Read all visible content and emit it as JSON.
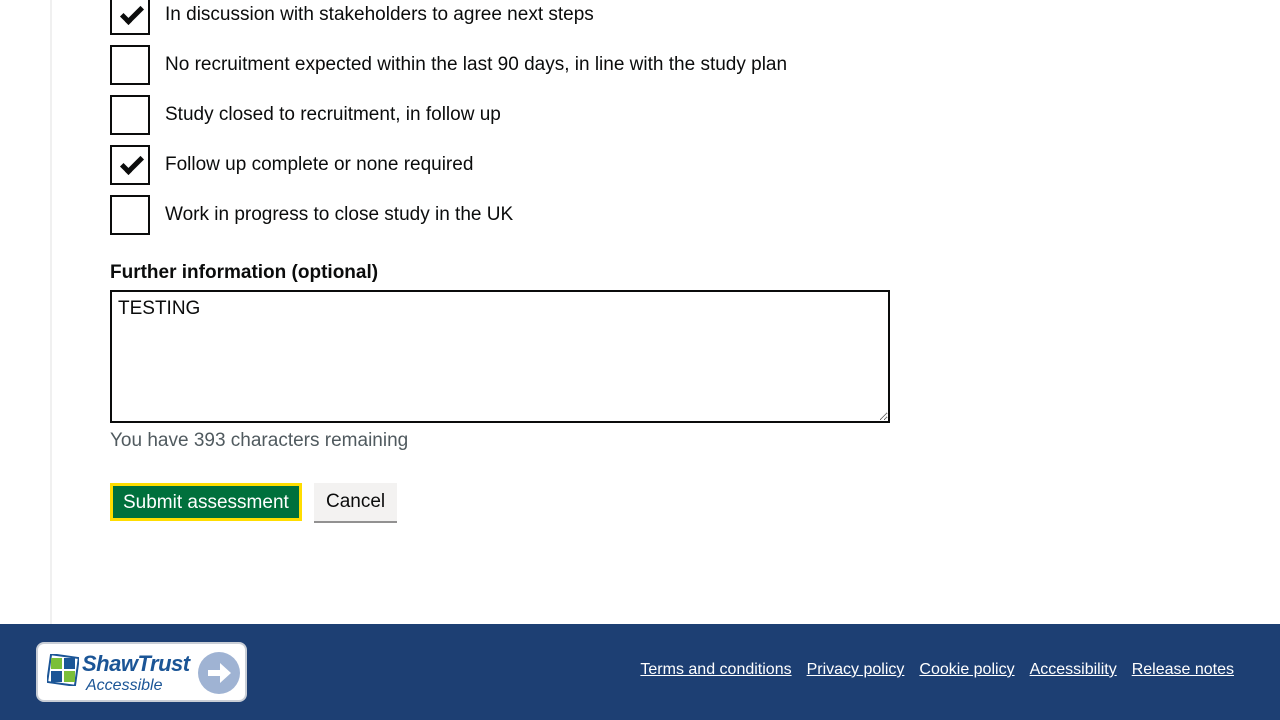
{
  "form": {
    "checkboxes": [
      {
        "label": "In discussion with stakeholders to agree next steps",
        "checked": true
      },
      {
        "label": "No recruitment expected within the last 90 days, in line with the study plan",
        "checked": false
      },
      {
        "label": "Study closed to recruitment, in follow up",
        "checked": false
      },
      {
        "label": "Follow up complete or none required",
        "checked": true
      },
      {
        "label": "Work in progress to close study in the UK",
        "checked": false
      }
    ],
    "further_info_label": "Further information (optional)",
    "further_info_value": "TESTING",
    "characters_remaining": "You have 393 characters remaining",
    "submit_label": "Submit assessment",
    "cancel_label": "Cancel"
  },
  "footer": {
    "badge": {
      "title": "ShawTrust",
      "subtitle": "Accessible"
    },
    "links": [
      "Terms and conditions",
      "Privacy policy",
      "Cookie policy",
      "Accessibility",
      "Release notes"
    ]
  },
  "colors": {
    "primary_button": "#00703c",
    "focus": "#ffdd00",
    "footer_bg": "#1d3f73"
  }
}
